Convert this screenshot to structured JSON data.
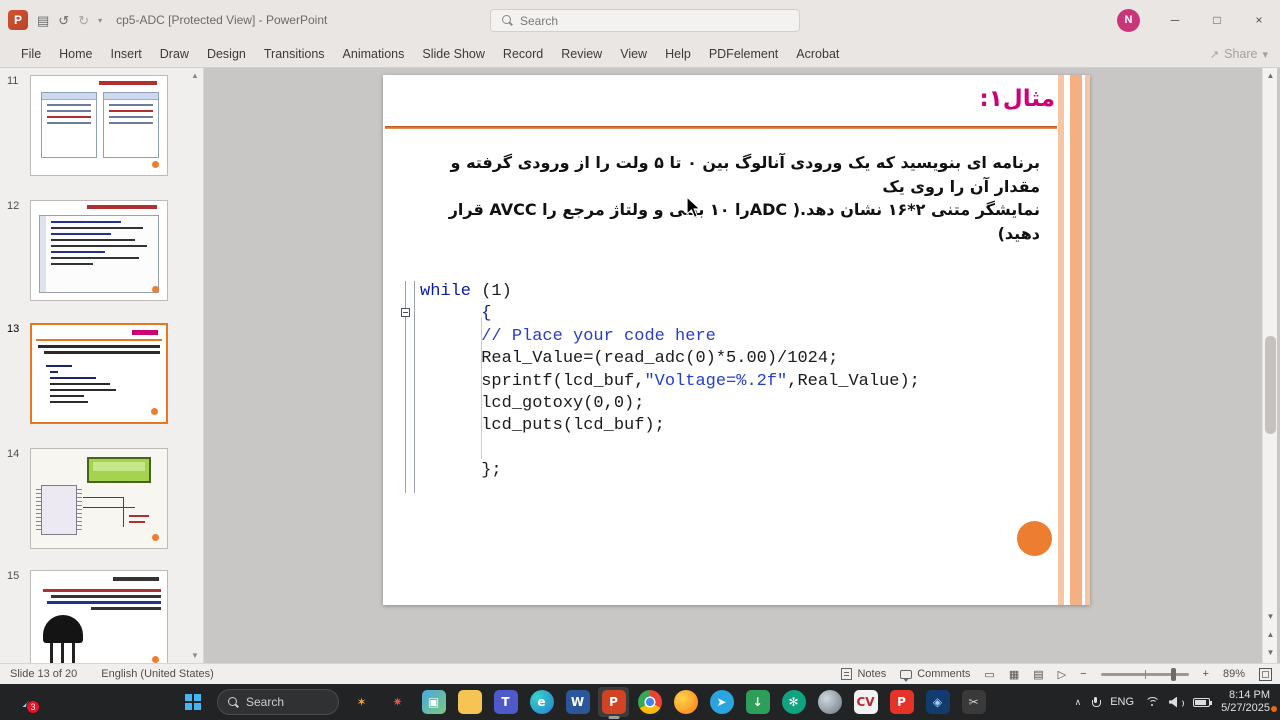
{
  "titlebar": {
    "app_title": "cp5-ADC [Protected View] - PowerPoint",
    "search_placeholder": "Search",
    "avatar_initial": "N"
  },
  "ribbon": {
    "tabs": [
      "File",
      "Home",
      "Insert",
      "Draw",
      "Design",
      "Transitions",
      "Animations",
      "Slide Show",
      "Record",
      "Review",
      "View",
      "Help",
      "PDFelement",
      "Acrobat"
    ],
    "share_label": "Share"
  },
  "thumbnail_panel": {
    "slides": [
      {
        "number": "11"
      },
      {
        "number": "12"
      },
      {
        "number": "13"
      },
      {
        "number": "14"
      },
      {
        "number": "15"
      }
    ],
    "selected_number": "13"
  },
  "slide": {
    "title": "مثال۱:",
    "body_lines": [
      "برنامه ای بنویسید که یک ورودی آنالوگ بین ۰ تا ۵ ولت را از ورودی گرفته و مقدار آن را روی یک",
      "نمایشگر متنی ۲*۱۶ نشان دهد.( ADCرا ۱۰ بیتی و ولتاژ مرجع را AVCC قرار دهید)"
    ],
    "code_lines": [
      [
        {
          "t": "while",
          "c": "kw"
        },
        {
          "t": " (1)",
          "c": "plain"
        }
      ],
      [
        {
          "t": "      {",
          "c": "kw"
        }
      ],
      [
        {
          "t": "      ",
          "c": "plain"
        },
        {
          "t": "// Place your code here",
          "c": "comment"
        }
      ],
      [
        {
          "t": "      Real_Value=(read_adc(0)*5.00)/1024;",
          "c": "plain"
        }
      ],
      [
        {
          "t": "      sprintf(lcd_buf,",
          "c": "plain"
        },
        {
          "t": "\"Voltage=%.2f\"",
          "c": "str"
        },
        {
          "t": ",Real_Value);",
          "c": "plain"
        }
      ],
      [
        {
          "t": "      lcd_gotoxy(0,0);",
          "c": "plain"
        }
      ],
      [
        {
          "t": "      lcd_puts(lcd_buf);",
          "c": "plain"
        }
      ],
      [],
      [
        {
          "t": "      };",
          "c": "plain"
        }
      ]
    ],
    "accent_orange": "#ed7d31",
    "title_color": "#cc0077"
  },
  "statusbar": {
    "slide_info": "Slide 13 of 20",
    "language": "English (United States)",
    "notes_label": "Notes",
    "comments_label": "Comments",
    "zoom_percent": "89%"
  },
  "taskbar": {
    "search_label": "Search",
    "badge_count": "3",
    "icons": [
      {
        "name": "fireworks-icon",
        "glyph": "✶",
        "fg": "#f5a623",
        "bg": "transparent"
      },
      {
        "name": "sparkler-icon",
        "glyph": "✷",
        "fg": "#e05b4b",
        "bg": "transparent"
      },
      {
        "name": "photos-icon",
        "glyph": "▣",
        "fg": "#ffffff",
        "bg": "linear-gradient(135deg,#4aa8e0,#7bc97b)"
      },
      {
        "name": "folder-icon",
        "glyph": "",
        "bg": "#f6c453"
      },
      {
        "name": "teams-icon",
        "glyph": "T",
        "fg": "#ffffff",
        "bg": "#5059c9"
      },
      {
        "name": "edge-icon",
        "glyph": "e",
        "fg": "#ffffff",
        "bg": "radial-gradient(circle at 30% 30%,#35d4c7,#2b7cd3)",
        "round": true
      },
      {
        "name": "word-icon",
        "glyph": "W",
        "fg": "#ffffff",
        "bg": "#2b579a"
      },
      {
        "name": "powerpoint-icon",
        "glyph": "P",
        "fg": "#ffffff",
        "bg": "#d04423",
        "active": true
      },
      {
        "name": "chrome-icon",
        "glyph": "",
        "bg": "radial-gradient(circle,#4285f4 0 4px,#fff 4px 5.5px,transparent 5.5px),conic-gradient(#ea4335 0 33%,#fbbc05 33% 66%,#34a853 66% 100%)",
        "round": true
      },
      {
        "name": "firefox-icon",
        "glyph": "",
        "bg": "radial-gradient(circle at 35% 35%,#ffd54a,#ff7a18)",
        "round": true
      },
      {
        "name": "telegram-icon",
        "glyph": "➤",
        "fg": "#ffffff",
        "bg": "#2aa5e0",
        "round": true
      },
      {
        "name": "downloads-icon",
        "glyph": "↓",
        "fg": "#ffffff",
        "bg": "#2e9e5b"
      },
      {
        "name": "chatgpt-icon",
        "glyph": "✻",
        "fg": "#ffffff",
        "bg": "#0fa47f",
        "round": true
      },
      {
        "name": "sphere-icon",
        "glyph": "",
        "bg": "radial-gradient(circle at 35% 35%,#cfd8e0,#6a7680)",
        "round": true
      },
      {
        "name": "cvavr-icon",
        "glyph": "CV",
        "fg": "#c0272d",
        "bg": "#f2f2f2"
      },
      {
        "name": "pdfelement-icon",
        "glyph": "P",
        "fg": "#ffffff",
        "bg": "#e5332a"
      },
      {
        "name": "proteus-icon",
        "glyph": "◈",
        "fg": "#9fd0ff",
        "bg": "#123c6e"
      },
      {
        "name": "snipping-icon",
        "glyph": "✂",
        "fg": "#d0d0d0",
        "bg": "#3a3a3a"
      }
    ],
    "tray": {
      "language": "ENG",
      "time": "8:14 PM",
      "date": "5/27/2025"
    }
  }
}
